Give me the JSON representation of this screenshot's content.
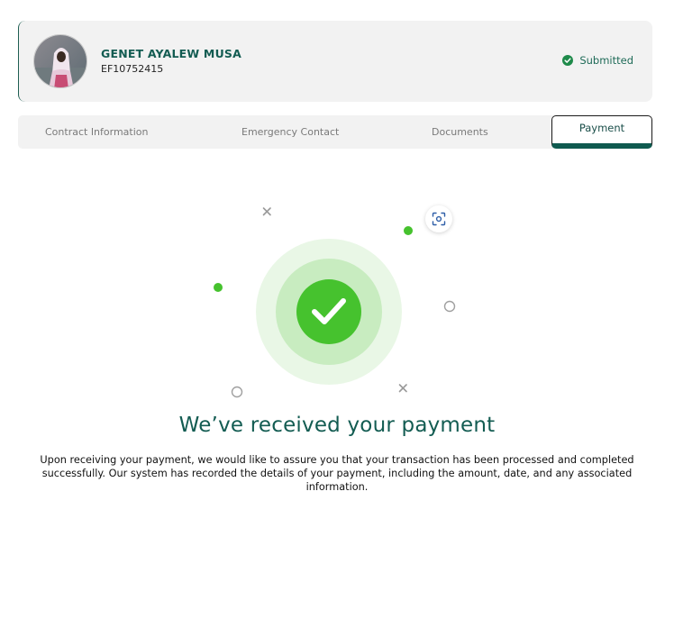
{
  "profile": {
    "name": "GENET AYALEW MUSA",
    "id": "EF10752415",
    "status": "Submitted",
    "status_icon": "check-circle-icon",
    "status_color": "#1e8a4a"
  },
  "tabs": [
    {
      "label": "Contract Information",
      "active": false
    },
    {
      "label": "Emergency Contact",
      "active": false
    },
    {
      "label": "Documents",
      "active": false
    },
    {
      "label": "Payment",
      "active": true
    }
  ],
  "payment": {
    "title": "We’ve received your payment",
    "message": "Upon receiving your payment, we would like to assure you that your transaction has been processed and completed successfully. Our system has recorded the details of your payment, including the amount, date, and any associated information.",
    "success_icon": "check-icon",
    "scan_icon": "scan-icon"
  },
  "colors": {
    "brand": "#135c52",
    "success_green": "#46c22e",
    "success_ring_inner": "#c8ecc0",
    "success_ring_outer": "#e9f7e6"
  }
}
